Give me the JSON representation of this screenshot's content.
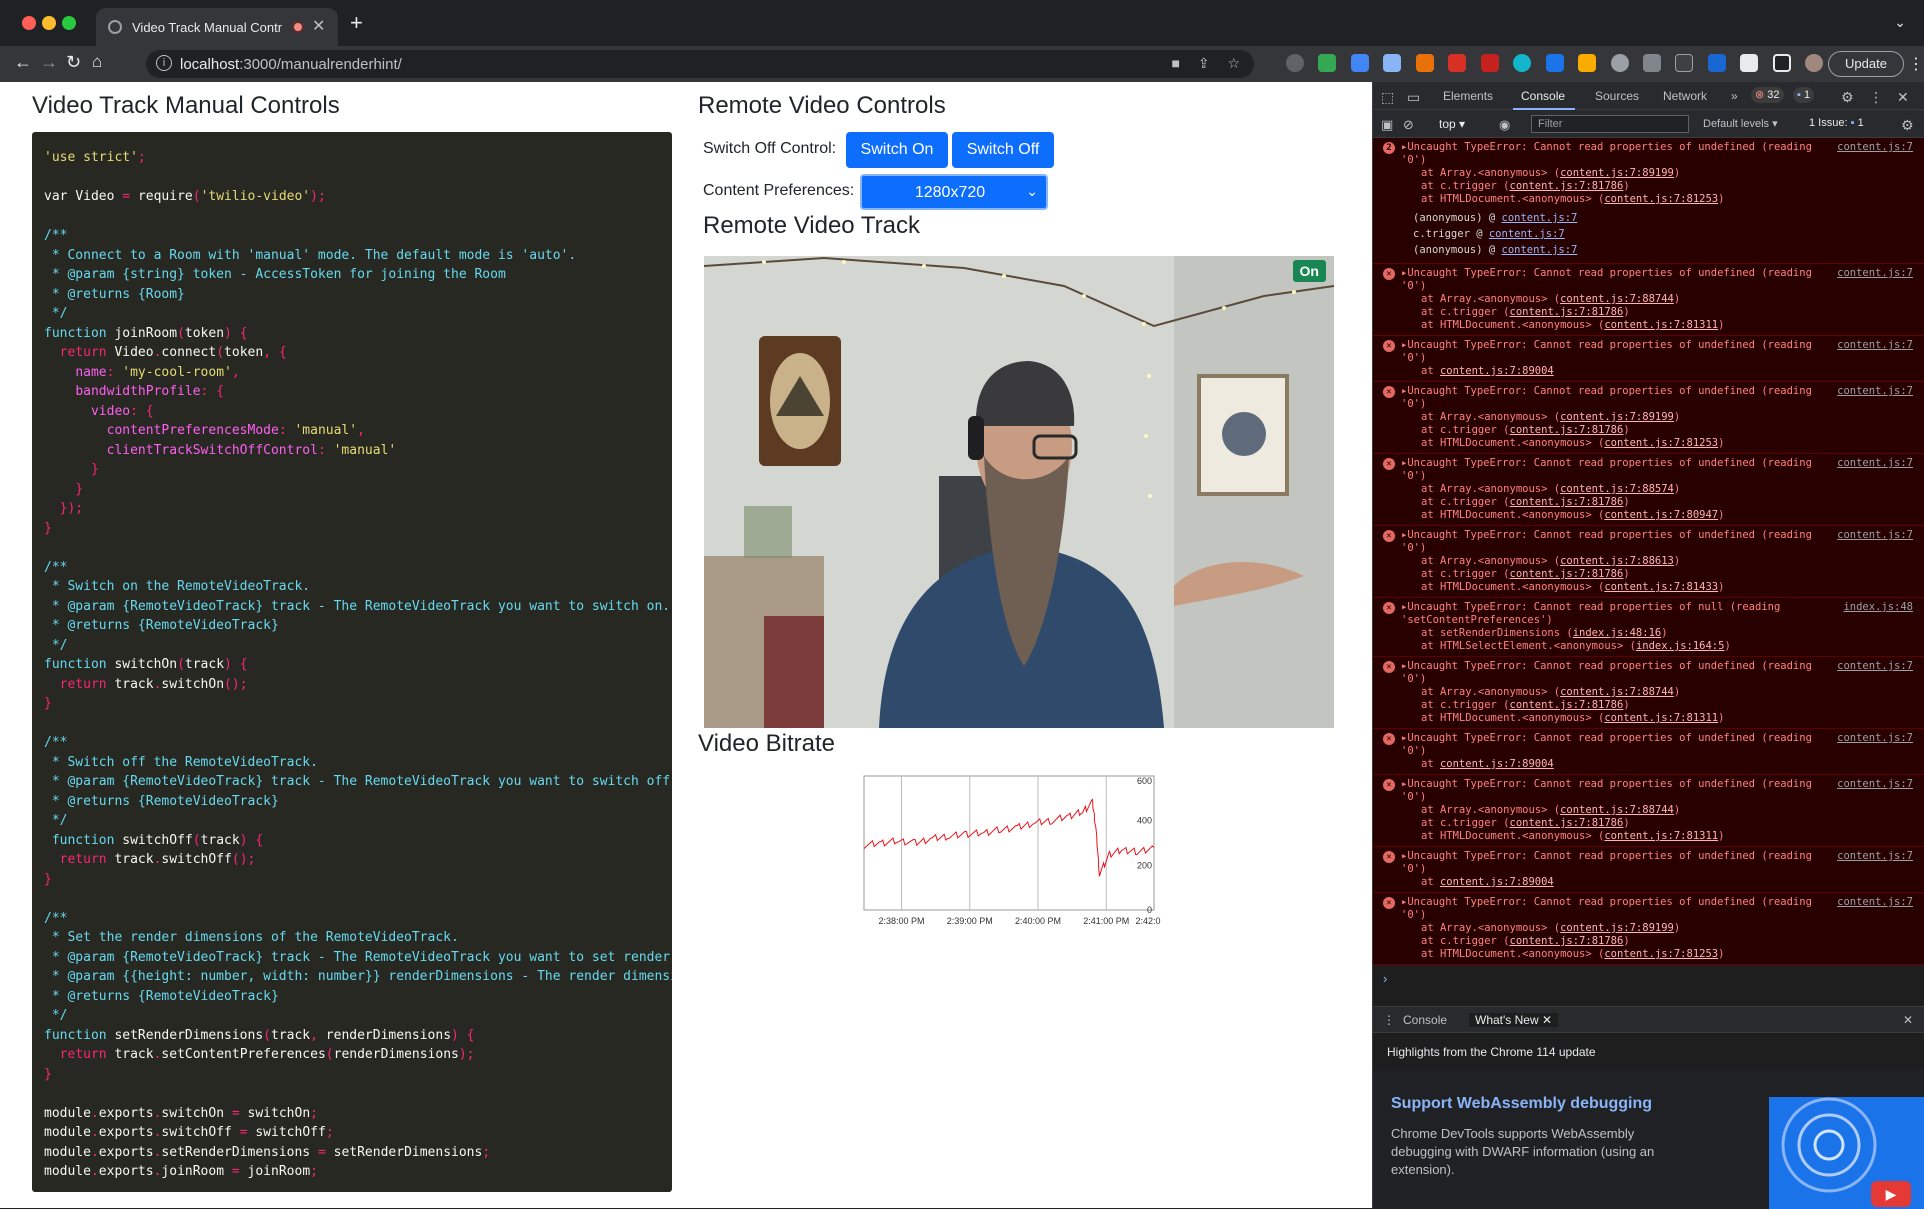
{
  "browser": {
    "tab_title": "Video Track Manual Contro",
    "url_host": "localhost",
    "url_path": ":3000/manualrenderhint/",
    "update_label": "Update"
  },
  "page": {
    "left_heading": "Video Track Manual Controls",
    "right_heading": "Remote Video Controls",
    "switch_off_label": "Switch Off Control:",
    "switch_on_button": "Switch On",
    "switch_off_button": "Switch Off",
    "content_pref_label": "Content Preferences:",
    "content_pref_value": "1280x720",
    "track_heading": "Remote Video Track",
    "track_badge": "On",
    "bitrate_heading": "Video Bitrate"
  },
  "code_lines": [
    [
      [
        "s",
        "'use strict'"
      ],
      [
        "p",
        ";"
      ]
    ],
    [],
    [
      [
        "t",
        "var "
      ],
      [
        "t",
        "Video "
      ],
      [
        "p",
        "= "
      ],
      [
        "t",
        "require"
      ],
      [
        "p",
        "("
      ],
      [
        "s",
        "'twilio-video'"
      ],
      [
        "p",
        ");"
      ]
    ],
    [],
    [
      [
        "c",
        "/**"
      ]
    ],
    [
      [
        "c",
        " * Connect to a Room with 'manual' mode. The default mode is 'auto'."
      ]
    ],
    [
      [
        "c",
        " * @param {string} token - AccessToken for joining the Room"
      ]
    ],
    [
      [
        "c",
        " * @returns {Room}"
      ]
    ],
    [
      [
        "c",
        " */"
      ]
    ],
    [
      [
        "c",
        "function "
      ],
      [
        "t",
        "joinRoom"
      ],
      [
        "p",
        "("
      ],
      [
        "t",
        "token"
      ],
      [
        "p",
        ") {"
      ]
    ],
    [
      [
        "t",
        "  "
      ],
      [
        "k",
        "return "
      ],
      [
        "t",
        "Video"
      ],
      [
        "p",
        "."
      ],
      [
        "t",
        "connect"
      ],
      [
        "p",
        "("
      ],
      [
        "t",
        "token"
      ],
      [
        "p",
        ", {"
      ]
    ],
    [
      [
        "t",
        "    "
      ],
      [
        "pr",
        "name"
      ],
      [
        "p",
        ": "
      ],
      [
        "s",
        "'my-cool-room'"
      ],
      [
        "p",
        ","
      ]
    ],
    [
      [
        "t",
        "    "
      ],
      [
        "pr",
        "bandwidthProfile"
      ],
      [
        "p",
        ": {"
      ]
    ],
    [
      [
        "t",
        "      "
      ],
      [
        "pr",
        "video"
      ],
      [
        "p",
        ": {"
      ]
    ],
    [
      [
        "t",
        "        "
      ],
      [
        "pr",
        "contentPreferencesMode"
      ],
      [
        "p",
        ": "
      ],
      [
        "s",
        "'manual'"
      ],
      [
        "p",
        ","
      ]
    ],
    [
      [
        "t",
        "        "
      ],
      [
        "pr",
        "clientTrackSwitchOffControl"
      ],
      [
        "p",
        ": "
      ],
      [
        "s",
        "'manual'"
      ]
    ],
    [
      [
        "p",
        "      }"
      ]
    ],
    [
      [
        "p",
        "    }"
      ]
    ],
    [
      [
        "p",
        "  });"
      ]
    ],
    [
      [
        "p",
        "}"
      ]
    ],
    [],
    [
      [
        "c",
        "/**"
      ]
    ],
    [
      [
        "c",
        " * Switch on the RemoteVideoTrack."
      ]
    ],
    [
      [
        "c",
        " * @param {RemoteVideoTrack} track - The RemoteVideoTrack you want to switch on."
      ]
    ],
    [
      [
        "c",
        " * @returns {RemoteVideoTrack}"
      ]
    ],
    [
      [
        "c",
        " */"
      ]
    ],
    [
      [
        "c",
        "function "
      ],
      [
        "t",
        "switchOn"
      ],
      [
        "p",
        "("
      ],
      [
        "t",
        "track"
      ],
      [
        "p",
        ") {"
      ]
    ],
    [
      [
        "t",
        "  "
      ],
      [
        "k",
        "return "
      ],
      [
        "t",
        "track"
      ],
      [
        "p",
        "."
      ],
      [
        "t",
        "switchOn"
      ],
      [
        "p",
        "();"
      ]
    ],
    [
      [
        "p",
        "}"
      ]
    ],
    [],
    [
      [
        "c",
        "/**"
      ]
    ],
    [
      [
        "c",
        " * Switch off the RemoteVideoTrack."
      ]
    ],
    [
      [
        "c",
        " * @param {RemoteVideoTrack} track - The RemoteVideoTrack you want to switch off."
      ]
    ],
    [
      [
        "c",
        " * @returns {RemoteVideoTrack}"
      ]
    ],
    [
      [
        "c",
        " */"
      ]
    ],
    [
      [
        "c",
        " function "
      ],
      [
        "t",
        "switchOff"
      ],
      [
        "p",
        "("
      ],
      [
        "t",
        "track"
      ],
      [
        "p",
        ") {"
      ]
    ],
    [
      [
        "t",
        "  "
      ],
      [
        "k",
        "return "
      ],
      [
        "t",
        "track"
      ],
      [
        "p",
        "."
      ],
      [
        "t",
        "switchOff"
      ],
      [
        "p",
        "();"
      ]
    ],
    [
      [
        "p",
        "}"
      ]
    ],
    [],
    [
      [
        "c",
        "/**"
      ]
    ],
    [
      [
        "c",
        " * Set the render dimensions of the RemoteVideoTrack."
      ]
    ],
    [
      [
        "c",
        " * @param {RemoteVideoTrack} track - The RemoteVideoTrack you want to set render"
      ]
    ],
    [
      [
        "c",
        " * @param {{height: number, width: number}} renderDimensions - The render dimensi"
      ]
    ],
    [
      [
        "c",
        " * @returns {RemoteVideoTrack}"
      ]
    ],
    [
      [
        "c",
        " */"
      ]
    ],
    [
      [
        "c",
        "function "
      ],
      [
        "t",
        "setRenderDimensions"
      ],
      [
        "p",
        "("
      ],
      [
        "t",
        "track"
      ],
      [
        "p",
        ", "
      ],
      [
        "t",
        "renderDimensions"
      ],
      [
        "p",
        ") {"
      ]
    ],
    [
      [
        "t",
        "  "
      ],
      [
        "k",
        "return "
      ],
      [
        "t",
        "track"
      ],
      [
        "p",
        "."
      ],
      [
        "t",
        "setContentPreferences"
      ],
      [
        "p",
        "("
      ],
      [
        "t",
        "renderDimensions"
      ],
      [
        "p",
        ");"
      ]
    ],
    [
      [
        "p",
        "}"
      ]
    ],
    [],
    [
      [
        "t",
        "module"
      ],
      [
        "p",
        "."
      ],
      [
        "t",
        "exports"
      ],
      [
        "p",
        "."
      ],
      [
        "t",
        "switchOn "
      ],
      [
        "p",
        "= "
      ],
      [
        "t",
        "switchOn"
      ],
      [
        "p",
        ";"
      ]
    ],
    [
      [
        "t",
        "module"
      ],
      [
        "p",
        "."
      ],
      [
        "t",
        "exports"
      ],
      [
        "p",
        "."
      ],
      [
        "t",
        "switchOff "
      ],
      [
        "p",
        "= "
      ],
      [
        "t",
        "switchOff"
      ],
      [
        "p",
        ";"
      ]
    ],
    [
      [
        "t",
        "module"
      ],
      [
        "p",
        "."
      ],
      [
        "t",
        "exports"
      ],
      [
        "p",
        "."
      ],
      [
        "t",
        "setRenderDimensions "
      ],
      [
        "p",
        "= "
      ],
      [
        "t",
        "setRenderDimensions"
      ],
      [
        "p",
        ";"
      ]
    ],
    [
      [
        "t",
        "module"
      ],
      [
        "p",
        "."
      ],
      [
        "t",
        "exports"
      ],
      [
        "p",
        "."
      ],
      [
        "t",
        "joinRoom "
      ],
      [
        "p",
        "= "
      ],
      [
        "t",
        "joinRoom"
      ],
      [
        "p",
        ";"
      ]
    ]
  ],
  "chart_data": {
    "type": "line",
    "title": "",
    "x_tick_labels": [
      "2:38:00 PM",
      "2:39:00 PM",
      "2:40:00 PM",
      "2:41:00 PM",
      "2:42:0"
    ],
    "y_tick_labels": [
      "600",
      "400",
      "200",
      "0"
    ],
    "ylim": [
      0,
      600
    ],
    "grid": true,
    "series": [
      {
        "color": "#e8141c",
        "x_minutes": [
          0,
          0.25,
          0.5,
          0.75,
          1.0,
          1.25,
          1.5,
          1.75,
          2.0,
          2.25,
          2.5,
          2.75,
          3.0,
          3.2,
          3.35,
          3.4,
          3.45,
          3.6,
          3.8,
          4.0,
          4.25
        ],
        "values": [
          290,
          300,
          310,
          300,
          320,
          330,
          340,
          345,
          360,
          370,
          390,
          400,
          420,
          440,
          480,
          360,
          160,
          250,
          270,
          260,
          280
        ]
      }
    ]
  },
  "devtools": {
    "tabs": [
      "Elements",
      "Console",
      "Sources",
      "Network"
    ],
    "active_tab": "Console",
    "error_count": "32",
    "message_count": "1",
    "context": "top",
    "filter_placeholder": "Filter",
    "levels": "Default levels",
    "issues": "1 Issue:",
    "issues_count": "1",
    "errors": [
      {
        "badge": "2",
        "message": "Uncaught TypeError: Cannot read properties of undefined (reading '0')",
        "source": "content.js:7",
        "stack": [
          [
            "at Array.<anonymous> (",
            "content.js:7:89199",
            ")"
          ],
          [
            "at c.trigger (",
            "content.js:7:81786",
            ")"
          ],
          [
            "at HTMLDocument.<anonymous> (",
            "content.js:7:81253",
            ")"
          ]
        ],
        "frames": [
          [
            "(anonymous) @ ",
            "content.js:7"
          ],
          [
            "c.trigger   @ ",
            "content.js:7"
          ],
          [
            "(anonymous) @ ",
            "content.js:7"
          ]
        ]
      },
      {
        "message": "Uncaught TypeError: Cannot read properties of undefined (reading '0')",
        "source": "content.js:7",
        "stack": [
          [
            "at Array.<anonymous> (",
            "content.js:7:88744",
            ")"
          ],
          [
            "at c.trigger (",
            "content.js:7:81786",
            ")"
          ],
          [
            "at HTMLDocument.<anonymous> (",
            "content.js:7:81311",
            ")"
          ]
        ]
      },
      {
        "message": "Uncaught TypeError: Cannot read properties of undefined (reading '0')",
        "source": "content.js:7",
        "stack": [
          [
            "at ",
            "content.js:7:89004",
            ""
          ]
        ]
      },
      {
        "message": "Uncaught TypeError: Cannot read properties of undefined (reading '0')",
        "source": "content.js:7",
        "stack": [
          [
            "at Array.<anonymous> (",
            "content.js:7:89199",
            ")"
          ],
          [
            "at c.trigger (",
            "content.js:7:81786",
            ")"
          ],
          [
            "at HTMLDocument.<anonymous> (",
            "content.js:7:81253",
            ")"
          ]
        ]
      },
      {
        "message": "Uncaught TypeError: Cannot read properties of undefined (reading '0')",
        "source": "content.js:7",
        "stack": [
          [
            "at Array.<anonymous> (",
            "content.js:7:88574",
            ")"
          ],
          [
            "at c.trigger (",
            "content.js:7:81786",
            ")"
          ],
          [
            "at HTMLDocument.<anonymous> (",
            "content.js:7:80947",
            ")"
          ]
        ]
      },
      {
        "message": "Uncaught TypeError: Cannot read properties of undefined (reading '0')",
        "source": "content.js:7",
        "stack": [
          [
            "at Array.<anonymous> (",
            "content.js:7:88613",
            ")"
          ],
          [
            "at c.trigger (",
            "content.js:7:81786",
            ")"
          ],
          [
            "at HTMLDocument.<anonymous> (",
            "content.js:7:81433",
            ")"
          ]
        ]
      },
      {
        "message": "Uncaught TypeError: Cannot read properties of null (reading 'setContentPreferences')",
        "source": "index.js:48",
        "stack": [
          [
            "at setRenderDimensions (",
            "index.js:48:16",
            ")"
          ],
          [
            "at HTMLSelectElement.<anonymous> (",
            "index.js:164:5",
            ")"
          ]
        ]
      },
      {
        "message": "Uncaught TypeError: Cannot read properties of undefined (reading '0')",
        "source": "content.js:7",
        "stack": [
          [
            "at Array.<anonymous> (",
            "content.js:7:88744",
            ")"
          ],
          [
            "at c.trigger (",
            "content.js:7:81786",
            ")"
          ],
          [
            "at HTMLDocument.<anonymous> (",
            "content.js:7:81311",
            ")"
          ]
        ]
      },
      {
        "message": "Uncaught TypeError: Cannot read properties of undefined (reading '0')",
        "source": "content.js:7",
        "stack": [
          [
            "at ",
            "content.js:7:89004",
            ""
          ]
        ]
      },
      {
        "message": "Uncaught TypeError: Cannot read properties of undefined (reading '0')",
        "source": "content.js:7",
        "stack": [
          [
            "at Array.<anonymous> (",
            "content.js:7:88744",
            ")"
          ],
          [
            "at c.trigger (",
            "content.js:7:81786",
            ")"
          ],
          [
            "at HTMLDocument.<anonymous> (",
            "content.js:7:81311",
            ")"
          ]
        ]
      },
      {
        "message": "Uncaught TypeError: Cannot read properties of undefined (reading '0')",
        "source": "content.js:7",
        "stack": [
          [
            "at ",
            "content.js:7:89004",
            ""
          ]
        ]
      },
      {
        "message": "Uncaught TypeError: Cannot read properties of undefined (reading '0')",
        "source": "content.js:7",
        "stack": [
          [
            "at Array.<anonymous> (",
            "content.js:7:89199",
            ")"
          ],
          [
            "at c.trigger (",
            "content.js:7:81786",
            ")"
          ],
          [
            "at HTMLDocument.<anonymous> (",
            "content.js:7:81253",
            ")"
          ]
        ]
      }
    ],
    "drawer": {
      "tabs": [
        "Console",
        "What's New"
      ],
      "active_tab": "What's New",
      "highlights": "Highlights from the Chrome 114 update",
      "feature_title": "Support WebAssembly debugging",
      "feature_text": "Chrome DevTools supports WebAssembly debugging with DWARF information (using an extension)."
    }
  }
}
